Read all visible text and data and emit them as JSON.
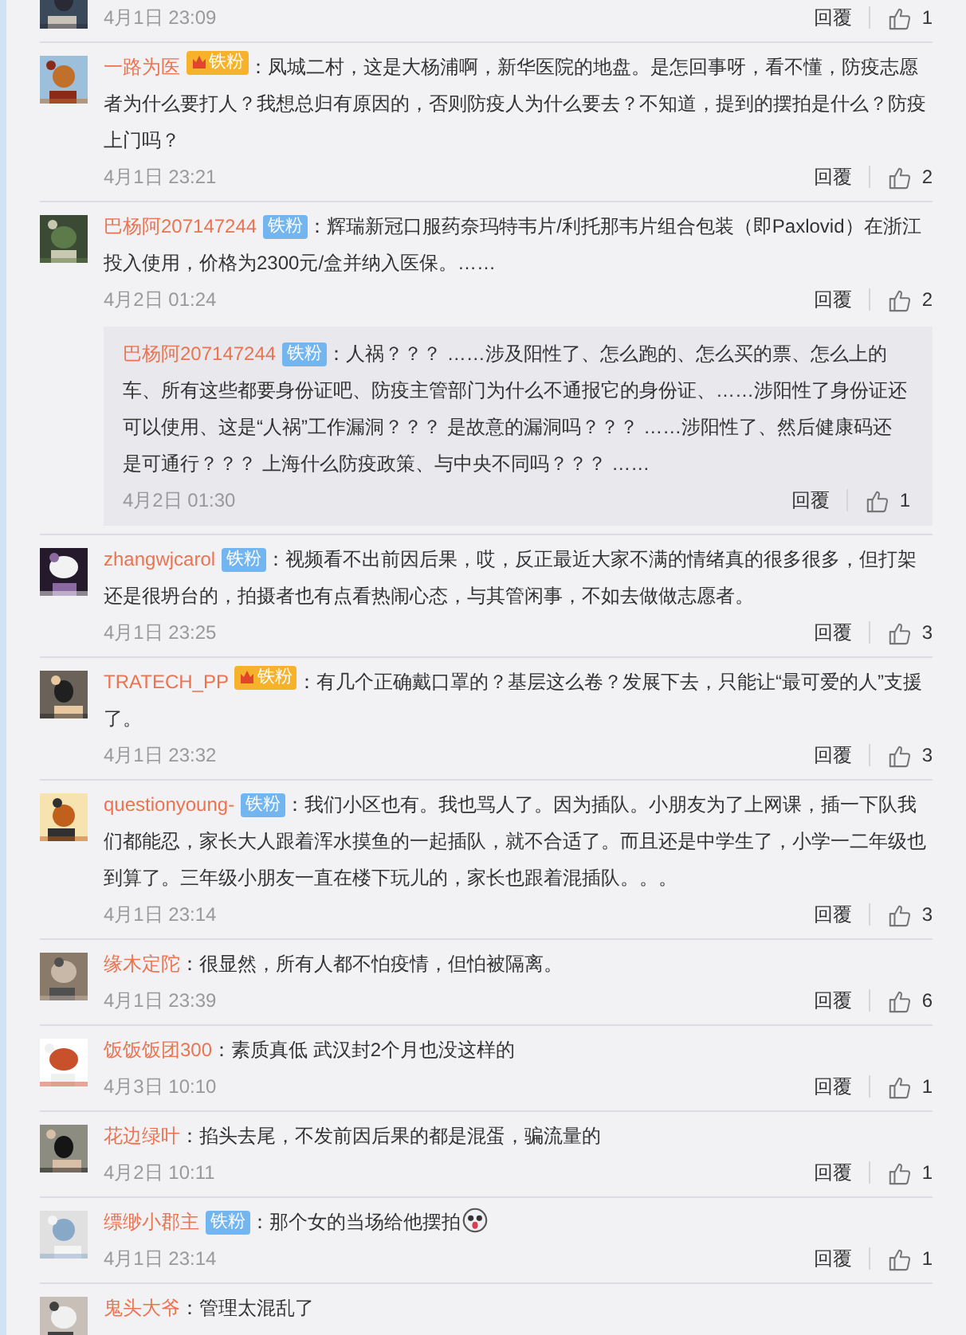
{
  "comments": [
    {
      "time": "4月1日 23:09",
      "reply_label": "回覆",
      "likes": "1"
    },
    {
      "user": "一路为医",
      "badge": {
        "kind": "gold",
        "label": "铁粉"
      },
      "text": "：凤城二村，这是大杨浦啊，新华医院的地盘。是怎回事呀，看不懂，防疫志愿者为什么要打人？我想总归有原因的，否则防疫人为什么要去？不知道，提到的摆拍是什么？防疫上门吗？",
      "time": "4月1日 23:21",
      "reply_label": "回覆",
      "likes": "2"
    },
    {
      "user": "巴杨阿207147244",
      "badge": {
        "kind": "fan",
        "label": "铁粉"
      },
      "text": "：辉瑞新冠口服药奈玛特韦片/利托那韦片组合包装（即Paxlovid）在浙江投入使用，价格为2300元/盒并纳入医保。……",
      "time": "4月2日 01:24",
      "reply_label": "回覆",
      "likes": "2",
      "replies": [
        {
          "user": "巴杨阿207147244",
          "badge": {
            "kind": "fan",
            "label": "铁粉"
          },
          "text": "：人祸？？？ ……涉及阳性了、怎么跑的、怎么买的票、怎么上的车、所有这些都要身份证吧、防疫主管部门为什么不通报它的身份证、……涉阳性了身份证还可以使用、这是“人祸”工作漏洞？？？ 是故意的漏洞吗？？？ ……涉阳性了、然后健康码还是可通行？？？ 上海什么防疫政策、与中央不同吗？？？ ……",
          "time": "4月2日 01:30",
          "reply_label": "回覆",
          "likes": "1"
        }
      ]
    },
    {
      "user": "zhangwjcarol",
      "badge": {
        "kind": "fan",
        "label": "铁粉"
      },
      "text": "：视频看不出前因后果，哎，反正最近大家不满的情绪真的很多很多，但打架还是很坍台的，拍摄者也有点看热闹心态，与其管闲事，不如去做做志愿者。",
      "time": "4月1日 23:25",
      "reply_label": "回覆",
      "likes": "3"
    },
    {
      "user": "TRATECH_PP",
      "badge": {
        "kind": "gold",
        "label": "铁粉"
      },
      "text": "：有几个正确戴口罩的？基层这么卷？发展下去，只能让“最可爱的人”支援了。",
      "time": "4月1日 23:32",
      "reply_label": "回覆",
      "likes": "3"
    },
    {
      "user": "questionyoung-",
      "badge": {
        "kind": "fan",
        "label": "铁粉"
      },
      "text": "：我们小区也有。我也骂人了。因为插队。小朋友为了上网课，插一下队我们都能忍，家长大人跟着浑水摸鱼的一起插队，就不合适了。而且还是中学生了，小学一二年级也到算了。三年级小朋友一直在楼下玩儿的，家长也跟着混插队。。。",
      "time": "4月1日 23:14",
      "reply_label": "回覆",
      "likes": "3"
    },
    {
      "user": "缘木定陀",
      "text": "：很显然，所有人都不怕疫情，但怕被隔离。",
      "time": "4月1日 23:39",
      "reply_label": "回覆",
      "likes": "6"
    },
    {
      "user": "饭饭饭团300",
      "text": "：素质真低 武汉封2个月也没这样的",
      "time": "4月3日 10:10",
      "reply_label": "回覆",
      "likes": "1"
    },
    {
      "user": "花边绿叶",
      "text": "：掐头去尾，不发前因后果的都是混蛋，骗流量的",
      "time": "4月2日 10:11",
      "reply_label": "回覆",
      "likes": "1"
    },
    {
      "user": "缥缈小郡主",
      "badge": {
        "kind": "fan",
        "label": "铁粉"
      },
      "text": "：那个女的当场给他摆拍",
      "emoji": true,
      "time": "4月1日 23:14",
      "reply_label": "回覆",
      "likes": "1"
    },
    {
      "user": "鬼头大爷",
      "text": "：管理太混乱了"
    }
  ]
}
